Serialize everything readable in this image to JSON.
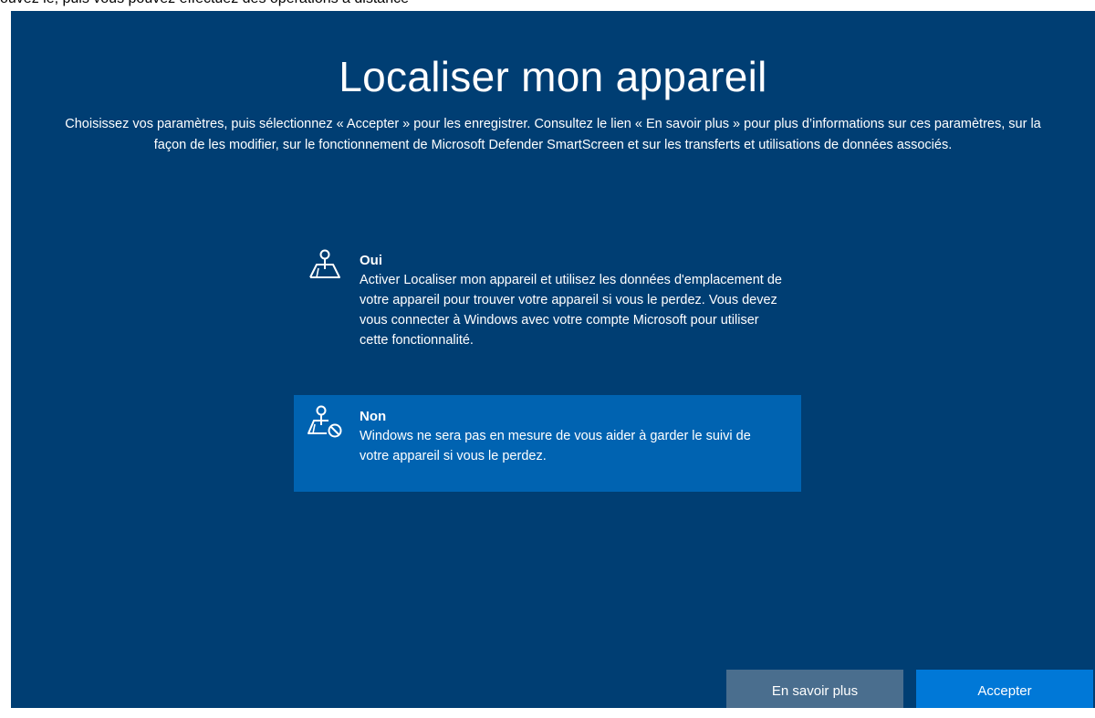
{
  "header_strip": {
    "text": "ouvez le, puis vous pouvez effectuez des opérations à distance"
  },
  "page": {
    "title": "Localiser mon appareil",
    "description": "Choisissez vos paramètres, puis sélectionnez « Accepter » pour les enregistrer. Consultez le lien « En savoir plus » pour plus d’informations sur ces paramètres, sur la façon de les modifier, sur le fonctionnement de Microsoft Defender SmartScreen et sur les transferts et utilisations de données associés."
  },
  "options": [
    {
      "title": "Oui",
      "text": "Activer Localiser mon appareil et utilisez les données d'emplacement de votre appareil pour trouver votre appareil si vous le perdez. Vous devez vous connecter à Windows avec votre compte Microsoft pour utiliser cette fonctionnalité.",
      "icon": "map-pin-icon",
      "selected": false
    },
    {
      "title": "Non",
      "text": "Windows ne sera pas en mesure de vous aider à garder le suivi de votre appareil si vous le perdez.",
      "icon": "map-pin-blocked-icon",
      "selected": true
    }
  ],
  "buttons": {
    "learn_more": "En savoir plus",
    "accept": "Accepter"
  },
  "colors": {
    "background": "#003e73",
    "selected_option": "#0063b1",
    "secondary_button": "#4a6e8e",
    "primary_button": "#0078d7"
  }
}
